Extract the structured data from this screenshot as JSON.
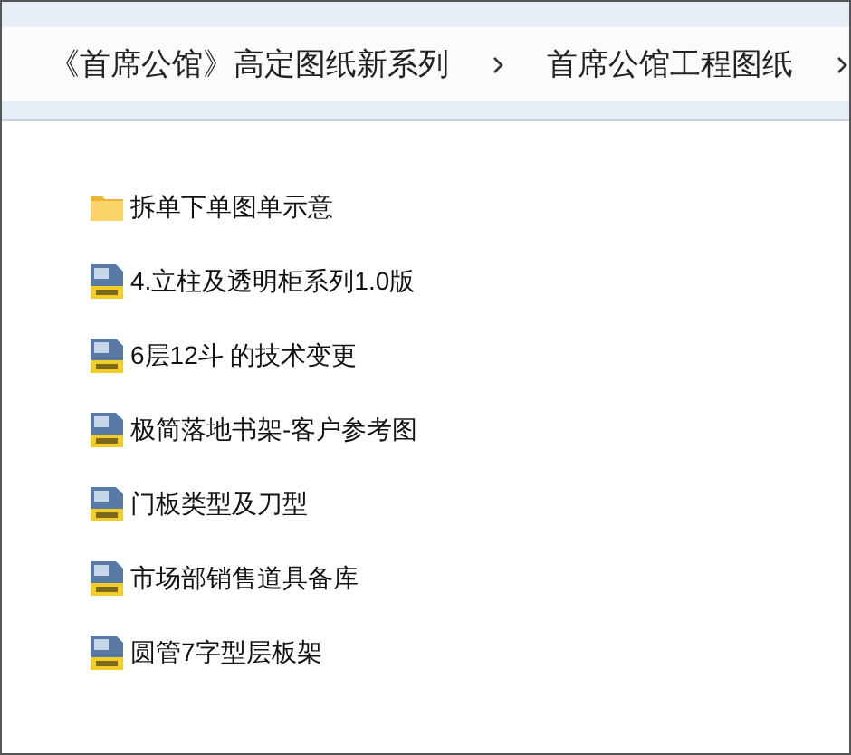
{
  "breadcrumb": [
    {
      "label": "《首席公馆》高定图纸新系列"
    },
    {
      "label": "首席公馆工程图纸"
    }
  ],
  "files": [
    {
      "name": "拆单下单图单示意",
      "kind": "folder"
    },
    {
      "name": "4.立柱及透明柜系列1.0版",
      "kind": "dwg"
    },
    {
      "name": "6层12斗 的技术变更",
      "kind": "dwg"
    },
    {
      "name": "极简落地书架-客户参考图",
      "kind": "dwg"
    },
    {
      "name": "门板类型及刀型",
      "kind": "dwg"
    },
    {
      "name": "市场部销售道具备库",
      "kind": "dwg"
    },
    {
      "name": "圆管7字型层板架",
      "kind": "dwg"
    }
  ]
}
